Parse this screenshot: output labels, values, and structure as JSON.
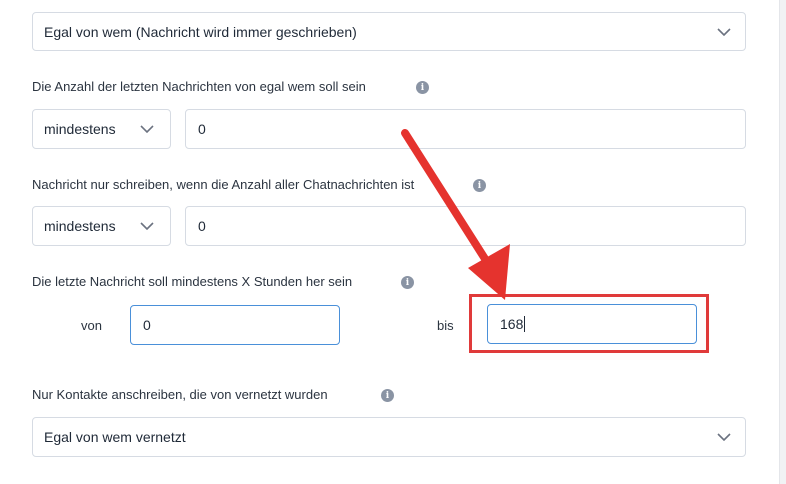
{
  "filters": {
    "sender_select": {
      "value": "Egal von wem (Nachricht wird immer geschrieben)"
    },
    "last_messages_count": {
      "label": "Die Anzahl der letzten Nachrichten von egal wem soll sein",
      "operator": "mindestens",
      "value": "0"
    },
    "total_chat_messages": {
      "label": "Nachricht nur schreiben, wenn die Anzahl aller Chatnachrichten ist",
      "operator": "mindestens",
      "value": "0"
    },
    "hours_since_last_message": {
      "label": "Die letzte Nachricht soll mindestens X Stunden her sein",
      "from_label": "von",
      "from_value": "0",
      "to_label": "bis",
      "to_value": "168"
    },
    "connected_contacts": {
      "label": "Nur Kontakte anschreiben, die von vernetzt wurden",
      "value": "Egal von wem vernetzt"
    }
  },
  "icons": {
    "info": "info-icon",
    "dropdown": "chevron-down-icon"
  },
  "annotation": {
    "arrow_color": "#e5332e",
    "highlight_color": "#e03a3a"
  },
  "colors": {
    "border": "#d6dbe3",
    "focus_border": "#4a90d9",
    "info_icon": "#8a94a4"
  }
}
